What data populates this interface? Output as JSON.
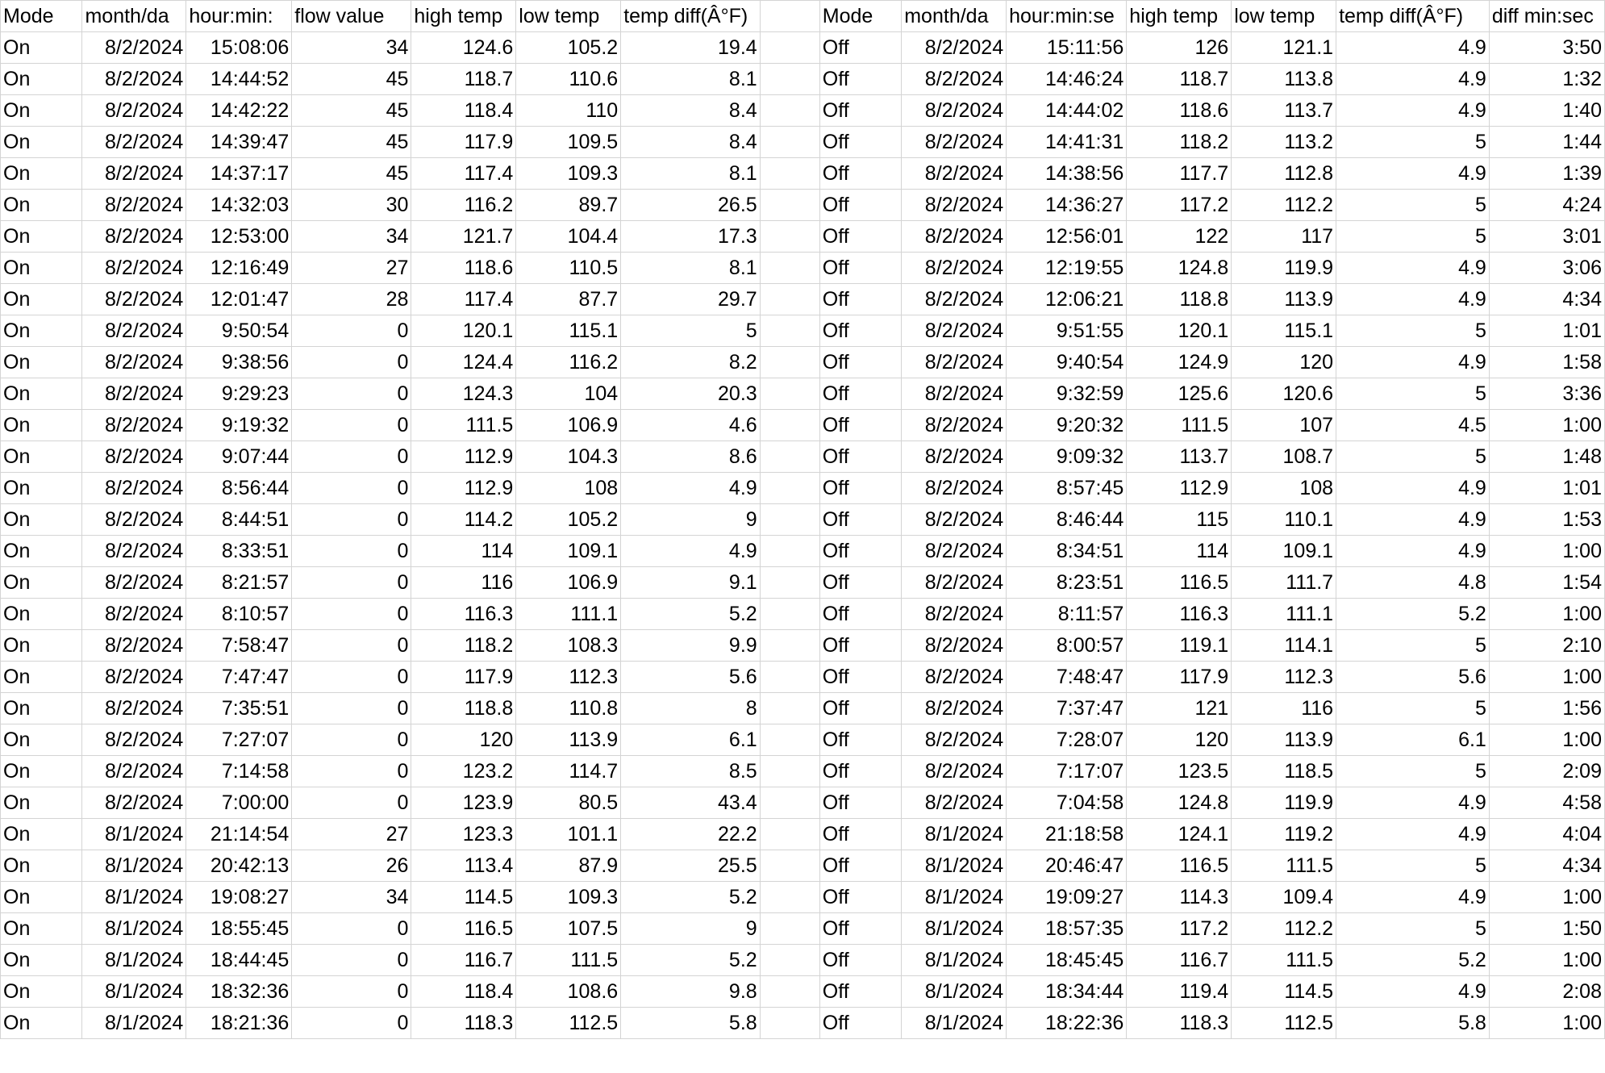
{
  "sheet": {
    "headers": [
      "Mode",
      "month/da",
      "hour:min:",
      "flow value",
      "high temp",
      "low temp",
      "temp diff(Â°F)",
      "",
      "Mode",
      "month/da",
      "hour:min:se",
      "high temp",
      "low temp",
      "temp diff(Â°F)",
      "diff min:sec"
    ],
    "rows": [
      [
        "On",
        "8/2/2024",
        "15:08:06",
        "34",
        "124.6",
        "105.2",
        "19.4",
        "",
        "Off",
        "8/2/2024",
        "15:11:56",
        "126",
        "121.1",
        "4.9",
        "3:50"
      ],
      [
        "On",
        "8/2/2024",
        "14:44:52",
        "45",
        "118.7",
        "110.6",
        "8.1",
        "",
        "Off",
        "8/2/2024",
        "14:46:24",
        "118.7",
        "113.8",
        "4.9",
        "1:32"
      ],
      [
        "On",
        "8/2/2024",
        "14:42:22",
        "45",
        "118.4",
        "110",
        "8.4",
        "",
        "Off",
        "8/2/2024",
        "14:44:02",
        "118.6",
        "113.7",
        "4.9",
        "1:40"
      ],
      [
        "On",
        "8/2/2024",
        "14:39:47",
        "45",
        "117.9",
        "109.5",
        "8.4",
        "",
        "Off",
        "8/2/2024",
        "14:41:31",
        "118.2",
        "113.2",
        "5",
        "1:44"
      ],
      [
        "On",
        "8/2/2024",
        "14:37:17",
        "45",
        "117.4",
        "109.3",
        "8.1",
        "",
        "Off",
        "8/2/2024",
        "14:38:56",
        "117.7",
        "112.8",
        "4.9",
        "1:39"
      ],
      [
        "On",
        "8/2/2024",
        "14:32:03",
        "30",
        "116.2",
        "89.7",
        "26.5",
        "",
        "Off",
        "8/2/2024",
        "14:36:27",
        "117.2",
        "112.2",
        "5",
        "4:24"
      ],
      [
        "On",
        "8/2/2024",
        "12:53:00",
        "34",
        "121.7",
        "104.4",
        "17.3",
        "",
        "Off",
        "8/2/2024",
        "12:56:01",
        "122",
        "117",
        "5",
        "3:01"
      ],
      [
        "On",
        "8/2/2024",
        "12:16:49",
        "27",
        "118.6",
        "110.5",
        "8.1",
        "",
        "Off",
        "8/2/2024",
        "12:19:55",
        "124.8",
        "119.9",
        "4.9",
        "3:06"
      ],
      [
        "On",
        "8/2/2024",
        "12:01:47",
        "28",
        "117.4",
        "87.7",
        "29.7",
        "",
        "Off",
        "8/2/2024",
        "12:06:21",
        "118.8",
        "113.9",
        "4.9",
        "4:34"
      ],
      [
        "On",
        "8/2/2024",
        "9:50:54",
        "0",
        "120.1",
        "115.1",
        "5",
        "",
        "Off",
        "8/2/2024",
        "9:51:55",
        "120.1",
        "115.1",
        "5",
        "1:01"
      ],
      [
        "On",
        "8/2/2024",
        "9:38:56",
        "0",
        "124.4",
        "116.2",
        "8.2",
        "",
        "Off",
        "8/2/2024",
        "9:40:54",
        "124.9",
        "120",
        "4.9",
        "1:58"
      ],
      [
        "On",
        "8/2/2024",
        "9:29:23",
        "0",
        "124.3",
        "104",
        "20.3",
        "",
        "Off",
        "8/2/2024",
        "9:32:59",
        "125.6",
        "120.6",
        "5",
        "3:36"
      ],
      [
        "On",
        "8/2/2024",
        "9:19:32",
        "0",
        "111.5",
        "106.9",
        "4.6",
        "",
        "Off",
        "8/2/2024",
        "9:20:32",
        "111.5",
        "107",
        "4.5",
        "1:00"
      ],
      [
        "On",
        "8/2/2024",
        "9:07:44",
        "0",
        "112.9",
        "104.3",
        "8.6",
        "",
        "Off",
        "8/2/2024",
        "9:09:32",
        "113.7",
        "108.7",
        "5",
        "1:48"
      ],
      [
        "On",
        "8/2/2024",
        "8:56:44",
        "0",
        "112.9",
        "108",
        "4.9",
        "",
        "Off",
        "8/2/2024",
        "8:57:45",
        "112.9",
        "108",
        "4.9",
        "1:01"
      ],
      [
        "On",
        "8/2/2024",
        "8:44:51",
        "0",
        "114.2",
        "105.2",
        "9",
        "",
        "Off",
        "8/2/2024",
        "8:46:44",
        "115",
        "110.1",
        "4.9",
        "1:53"
      ],
      [
        "On",
        "8/2/2024",
        "8:33:51",
        "0",
        "114",
        "109.1",
        "4.9",
        "",
        "Off",
        "8/2/2024",
        "8:34:51",
        "114",
        "109.1",
        "4.9",
        "1:00"
      ],
      [
        "On",
        "8/2/2024",
        "8:21:57",
        "0",
        "116",
        "106.9",
        "9.1",
        "",
        "Off",
        "8/2/2024",
        "8:23:51",
        "116.5",
        "111.7",
        "4.8",
        "1:54"
      ],
      [
        "On",
        "8/2/2024",
        "8:10:57",
        "0",
        "116.3",
        "111.1",
        "5.2",
        "",
        "Off",
        "8/2/2024",
        "8:11:57",
        "116.3",
        "111.1",
        "5.2",
        "1:00"
      ],
      [
        "On",
        "8/2/2024",
        "7:58:47",
        "0",
        "118.2",
        "108.3",
        "9.9",
        "",
        "Off",
        "8/2/2024",
        "8:00:57",
        "119.1",
        "114.1",
        "5",
        "2:10"
      ],
      [
        "On",
        "8/2/2024",
        "7:47:47",
        "0",
        "117.9",
        "112.3",
        "5.6",
        "",
        "Off",
        "8/2/2024",
        "7:48:47",
        "117.9",
        "112.3",
        "5.6",
        "1:00"
      ],
      [
        "On",
        "8/2/2024",
        "7:35:51",
        "0",
        "118.8",
        "110.8",
        "8",
        "",
        "Off",
        "8/2/2024",
        "7:37:47",
        "121",
        "116",
        "5",
        "1:56"
      ],
      [
        "On",
        "8/2/2024",
        "7:27:07",
        "0",
        "120",
        "113.9",
        "6.1",
        "",
        "Off",
        "8/2/2024",
        "7:28:07",
        "120",
        "113.9",
        "6.1",
        "1:00"
      ],
      [
        "On",
        "8/2/2024",
        "7:14:58",
        "0",
        "123.2",
        "114.7",
        "8.5",
        "",
        "Off",
        "8/2/2024",
        "7:17:07",
        "123.5",
        "118.5",
        "5",
        "2:09"
      ],
      [
        "On",
        "8/2/2024",
        "7:00:00",
        "0",
        "123.9",
        "80.5",
        "43.4",
        "",
        "Off",
        "8/2/2024",
        "7:04:58",
        "124.8",
        "119.9",
        "4.9",
        "4:58"
      ],
      [
        "On",
        "8/1/2024",
        "21:14:54",
        "27",
        "123.3",
        "101.1",
        "22.2",
        "",
        "Off",
        "8/1/2024",
        "21:18:58",
        "124.1",
        "119.2",
        "4.9",
        "4:04"
      ],
      [
        "On",
        "8/1/2024",
        "20:42:13",
        "26",
        "113.4",
        "87.9",
        "25.5",
        "",
        "Off",
        "8/1/2024",
        "20:46:47",
        "116.5",
        "111.5",
        "5",
        "4:34"
      ],
      [
        "On",
        "8/1/2024",
        "19:08:27",
        "34",
        "114.5",
        "109.3",
        "5.2",
        "",
        "Off",
        "8/1/2024",
        "19:09:27",
        "114.3",
        "109.4",
        "4.9",
        "1:00"
      ],
      [
        "On",
        "8/1/2024",
        "18:55:45",
        "0",
        "116.5",
        "107.5",
        "9",
        "",
        "Off",
        "8/1/2024",
        "18:57:35",
        "117.2",
        "112.2",
        "5",
        "1:50"
      ],
      [
        "On",
        "8/1/2024",
        "18:44:45",
        "0",
        "116.7",
        "111.5",
        "5.2",
        "",
        "Off",
        "8/1/2024",
        "18:45:45",
        "116.7",
        "111.5",
        "5.2",
        "1:00"
      ],
      [
        "On",
        "8/1/2024",
        "18:32:36",
        "0",
        "118.4",
        "108.6",
        "9.8",
        "",
        "Off",
        "8/1/2024",
        "18:34:44",
        "119.4",
        "114.5",
        "4.9",
        "2:08"
      ],
      [
        "On",
        "8/1/2024",
        "18:21:36",
        "0",
        "118.3",
        "112.5",
        "5.8",
        "",
        "Off",
        "8/1/2024",
        "18:22:36",
        "118.3",
        "112.5",
        "5.8",
        "1:00"
      ]
    ]
  },
  "colors": {
    "gridline": "#d4d4d4",
    "background": "#ffffff",
    "text": "#000000"
  }
}
